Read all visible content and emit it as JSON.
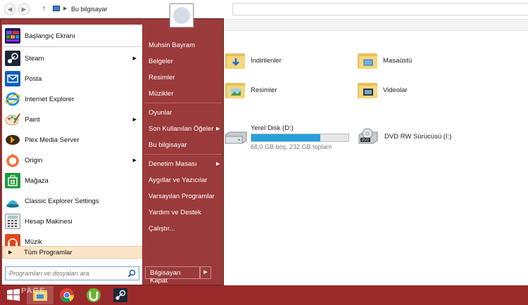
{
  "explorer": {
    "address": "Bu bilgisayar",
    "folders": [
      {
        "label": "İndirilenler",
        "icon": "downloads-folder-icon"
      },
      {
        "label": "Masaüstü",
        "icon": "desktop-folder-icon"
      },
      {
        "label": "Resimler",
        "icon": "pictures-folder-icon"
      },
      {
        "label": "Videolar",
        "icon": "videos-folder-icon"
      }
    ],
    "drives": [
      {
        "label": "Yerel Disk (D:)",
        "sub": "68,0 GB boş, 232 GB toplam",
        "used_fraction": 0.71
      },
      {
        "label": "DVD RW Sürücüsü (I:)"
      }
    ]
  },
  "start_menu": {
    "programs": [
      {
        "label": "Başlangıç Ekranı",
        "icon": "start-screen-icon",
        "submenu": false
      },
      {
        "label": "Steam",
        "icon": "steam-icon",
        "submenu": true
      },
      {
        "label": "Posta",
        "icon": "mail-icon",
        "submenu": false
      },
      {
        "label": "Internet Explorer",
        "icon": "internet-explorer-icon",
        "submenu": false
      },
      {
        "label": "Paint",
        "icon": "paint-icon",
        "submenu": true
      },
      {
        "label": "Plex Media Server",
        "icon": "plex-icon",
        "submenu": false
      },
      {
        "label": "Origin",
        "icon": "origin-icon",
        "submenu": true
      },
      {
        "label": "Mağaza",
        "icon": "store-icon",
        "submenu": false
      },
      {
        "label": "Classic Explorer Settings",
        "icon": "classic-explorer-icon",
        "submenu": false
      },
      {
        "label": "Hesap Makinesi",
        "icon": "calculator-icon",
        "submenu": false
      },
      {
        "label": "Müzik",
        "icon": "music-icon",
        "submenu": false
      }
    ],
    "all_programs": "Tüm Programlar",
    "search_placeholder": "Programları ve dosyaları ara",
    "right_items": [
      {
        "label": "Muhsin Bayram",
        "submenu": false
      },
      {
        "label": "Belgeler",
        "submenu": false
      },
      {
        "label": "Resimler",
        "submenu": false
      },
      {
        "label": "Müzikler",
        "submenu": false
      },
      {
        "label": "Oyunlar",
        "submenu": false
      },
      {
        "label": "Son Kullanılan Öğeler",
        "submenu": true
      },
      {
        "label": "Bu bilgisayar",
        "submenu": false
      },
      {
        "label": "Denetim Masası",
        "submenu": true
      },
      {
        "label": "Aygıtlar ve Yazıcılar",
        "submenu": false
      },
      {
        "label": "Varsayılan Programlar",
        "submenu": false
      },
      {
        "label": "Yardım ve Destek",
        "submenu": false
      },
      {
        "label": "Çalıştır...",
        "submenu": false
      }
    ],
    "shutdown_label": "Bilgisayarı Kapat"
  },
  "taskbar": {
    "watermark": "PAGE",
    "items": [
      "start-button-icon",
      "file-explorer-icon",
      "chrome-icon",
      "utorrent-icon",
      "steam-icon"
    ]
  },
  "colors": {
    "start_accent": "#9b3a3a",
    "taskbar": "#9a2a2a",
    "progress": "#26a0da"
  }
}
